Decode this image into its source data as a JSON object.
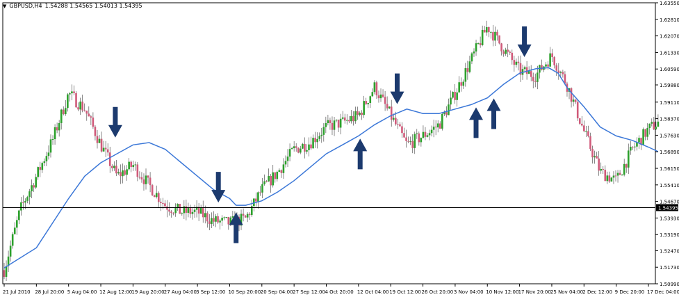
{
  "header": {
    "menu_icon": "triangle-down-icon",
    "symbol": "GBPUSD,H4",
    "ohlc": "1.54288 1.54565 1.54013 1.54395"
  },
  "colors": {
    "background": "#ffffff",
    "bull": "#2ca02c",
    "bear": "#d05a7a",
    "wick": "#555555",
    "ma": "#3c78d8",
    "arrow": "#1c3a6e",
    "axis": "#000000"
  },
  "chart_data": {
    "type": "line",
    "title": "",
    "xlabel": "",
    "ylabel": "",
    "ylim": [
      1.5099,
      1.6355
    ],
    "grid": false,
    "y_ticks": [
      "1.63550",
      "1.62810",
      "1.62070",
      "1.61330",
      "1.60590",
      "1.59880",
      "1.59110",
      "1.58370",
      "1.57630",
      "1.56890",
      "1.56150",
      "1.55410",
      "1.54670",
      "1.53930",
      "1.53190",
      "1.52470",
      "1.51730",
      "1.50990"
    ],
    "x_ticks": [
      "21 Jul 2010",
      "28 Jul 20:00",
      "5 Aug 04:00",
      "12 Aug 12:00",
      "19 Aug 20:00",
      "27 Aug 04:00",
      "3 Sep 12:00",
      "10 Sep 20:00",
      "20 Sep 04:00",
      "27 Sep 12:00",
      "4 Oct 20:00",
      "12 Oct 04:00",
      "19 Oct 12:00",
      "26 Oct 20:00",
      "3 Nov 04:00",
      "10 Nov 12:00",
      "17 Nov 20:00",
      "25 Nov 04:00",
      "2 Dec 12:00",
      "9 Dec 20:00",
      "17 Dec 04:00"
    ],
    "current_price": "1.54395",
    "price_series_x": [
      0,
      0.5,
      1,
      1.5,
      2,
      2.5,
      3,
      3.5,
      4,
      4.5,
      5,
      5.5,
      6,
      6.5,
      7,
      7.5,
      8,
      8.5,
      9,
      9.5,
      10,
      10.5,
      11,
      11.5,
      12,
      12.5,
      13,
      13.5,
      14,
      14.5,
      15,
      15.5,
      16,
      16.5,
      17,
      17.5,
      18,
      18.5,
      19,
      19.5,
      20,
      20.3
    ],
    "price_series": [
      1.516,
      1.543,
      1.558,
      1.574,
      1.595,
      1.588,
      1.572,
      1.558,
      1.563,
      1.554,
      1.545,
      1.542,
      1.542,
      1.538,
      1.537,
      1.539,
      1.552,
      1.56,
      1.57,
      1.573,
      1.58,
      1.582,
      1.585,
      1.598,
      1.585,
      1.572,
      1.576,
      1.581,
      1.595,
      1.61,
      1.625,
      1.615,
      1.605,
      1.603,
      1.612,
      1.598,
      1.578,
      1.56,
      1.556,
      1.57,
      1.579,
      1.582
    ],
    "moving_average_x": [
      0,
      1,
      2,
      2.5,
      3,
      3.5,
      4,
      4.5,
      5,
      5.5,
      6,
      6.5,
      7,
      7.2,
      7.5,
      8,
      8.5,
      9,
      9.5,
      10,
      10.5,
      11,
      11.5,
      12,
      12.5,
      13,
      13.5,
      14,
      14.5,
      15,
      15.5,
      16,
      16.5,
      16.9,
      17.2,
      17.5,
      18,
      18.5,
      19,
      19.5,
      20,
      20.3
    ],
    "moving_average": [
      1.517,
      1.526,
      1.548,
      1.558,
      1.564,
      1.568,
      1.572,
      1.573,
      1.57,
      1.564,
      1.558,
      1.552,
      1.548,
      1.545,
      1.545,
      1.547,
      1.551,
      1.556,
      1.562,
      1.568,
      1.572,
      1.576,
      1.581,
      1.585,
      1.588,
      1.586,
      1.586,
      1.588,
      1.59,
      1.593,
      1.599,
      1.604,
      1.606,
      1.6065,
      1.604,
      1.597,
      1.589,
      1.58,
      1.576,
      1.574,
      1.571,
      1.569
    ],
    "markers": [
      {
        "direction": "down",
        "x": 3.45,
        "y": 1.574
      },
      {
        "direction": "down",
        "x": 6.65,
        "y": 1.545
      },
      {
        "direction": "up",
        "x": 7.2,
        "y": 1.543
      },
      {
        "direction": "up",
        "x": 11.05,
        "y": 1.576
      },
      {
        "direction": "down",
        "x": 12.2,
        "y": 1.589
      },
      {
        "direction": "up",
        "x": 14.65,
        "y": 1.59
      },
      {
        "direction": "up",
        "x": 15.2,
        "y": 1.594
      },
      {
        "direction": "down",
        "x": 16.15,
        "y": 1.61
      }
    ]
  }
}
